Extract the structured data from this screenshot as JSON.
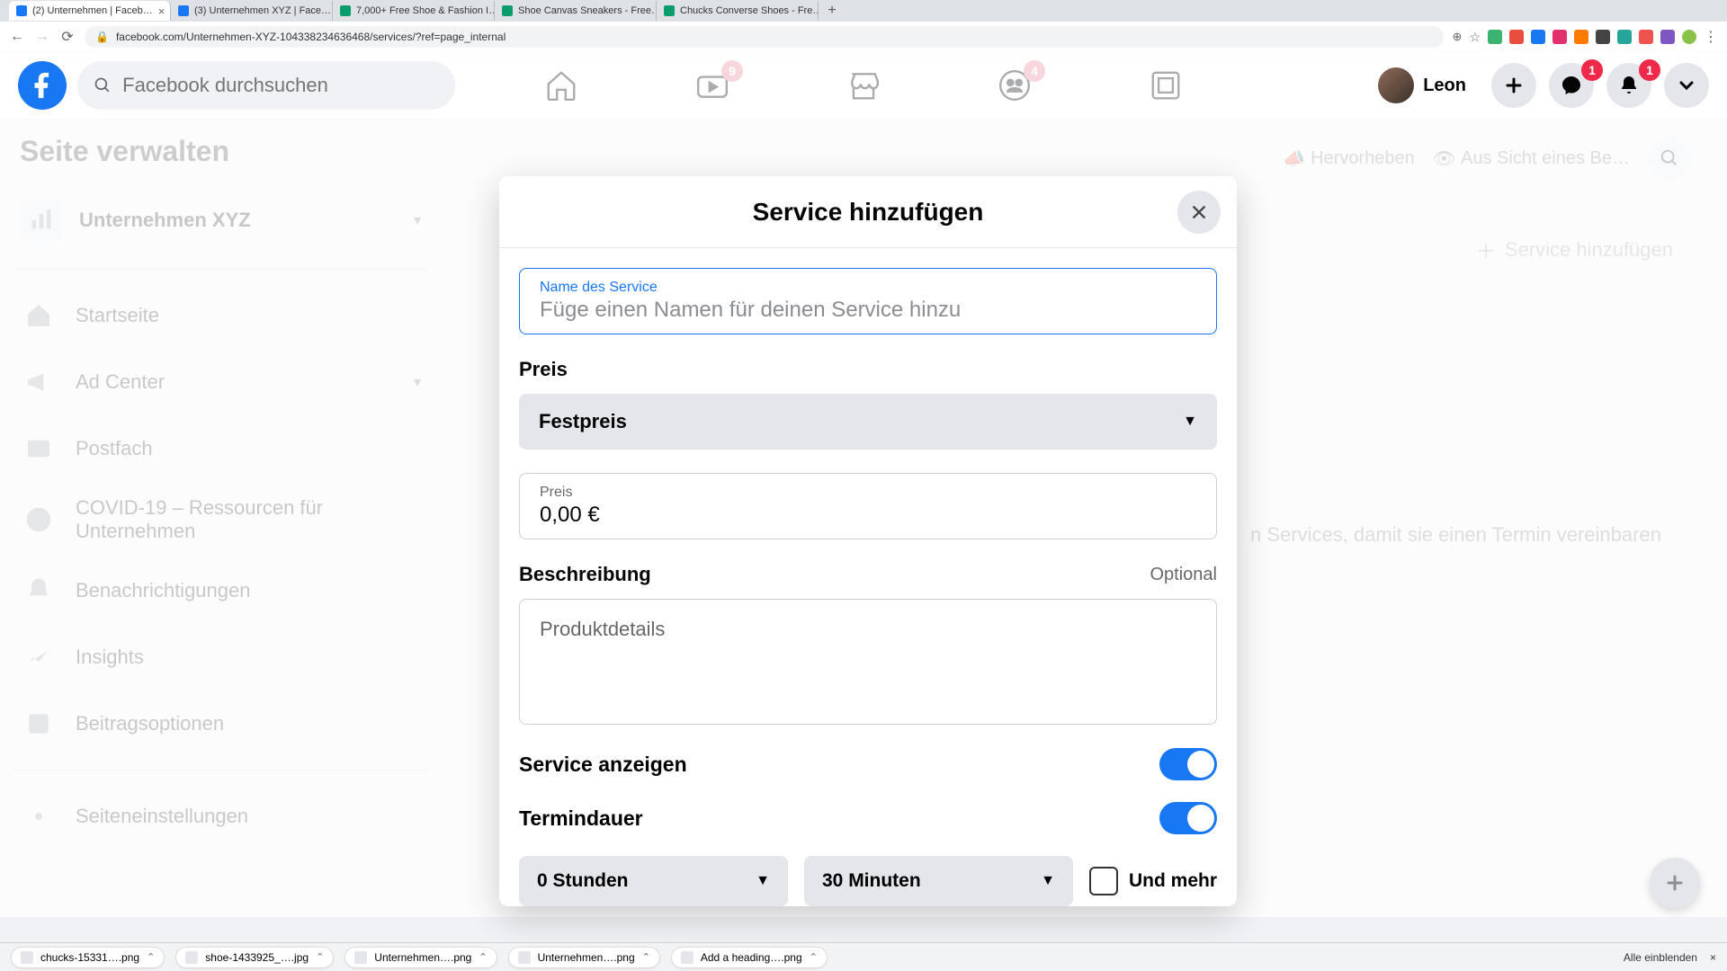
{
  "browser": {
    "tabs": [
      {
        "title": "(2) Unternehmen | Faceb…",
        "favicon": "fb"
      },
      {
        "title": "(3) Unternehmen XYZ | Face…",
        "favicon": "fb"
      },
      {
        "title": "7,000+ Free Shoe & Fashion I…",
        "favicon": "pb"
      },
      {
        "title": "Shoe Canvas Sneakers - Free…",
        "favicon": "pb"
      },
      {
        "title": "Chucks Converse Shoes - Fre…",
        "favicon": "pb"
      }
    ],
    "url": "facebook.com/Unternehmen-XYZ-104338234636468/services/?ref=page_internal"
  },
  "fb_header": {
    "search_placeholder": "Facebook durchsuchen",
    "badges": {
      "watch": "9",
      "groups": "4",
      "messenger": "1",
      "notifications": "1"
    },
    "profile_name": "Leon"
  },
  "sidebar": {
    "title": "Seite verwalten",
    "page_name": "Unternehmen XYZ",
    "items": [
      {
        "label": "Startseite"
      },
      {
        "label": "Ad Center"
      },
      {
        "label": "Postfach"
      },
      {
        "label": "COVID-19 – Ressourcen für Unternehmen"
      },
      {
        "label": "Benachrichtigungen"
      },
      {
        "label": "Insights"
      },
      {
        "label": "Beitragsoptionen"
      }
    ],
    "settings_label": "Seiteneinstellungen"
  },
  "toolbar": {
    "hervorheben": "Hervorheben",
    "aus_sicht": "Aus Sicht eines Be…",
    "add_service": "Service hinzufügen"
  },
  "bg_hint": "n Services, damit sie einen Termin vereinbaren",
  "modal": {
    "title": "Service hinzufügen",
    "name_label": "Name des Service",
    "name_placeholder": "Füge einen Namen für deinen Service hinzu",
    "preis_label": "Preis",
    "preis_type": "Festpreis",
    "preis_field_label": "Preis",
    "preis_value": "0,00 €",
    "beschreibung_label": "Beschreibung",
    "optional": "Optional",
    "beschreibung_placeholder": "Produktdetails",
    "service_anzeigen": "Service anzeigen",
    "termindauer": "Termindauer",
    "stunden": "0 Stunden",
    "minuten": "30 Minuten",
    "und_mehr": "Und mehr"
  },
  "downloads": {
    "items": [
      "chucks-15331….png",
      "shoe-1433925_….jpg",
      "Unternehmen….png",
      "Unternehmen….png",
      "Add a heading….png"
    ],
    "show_all": "Alle einblenden"
  }
}
